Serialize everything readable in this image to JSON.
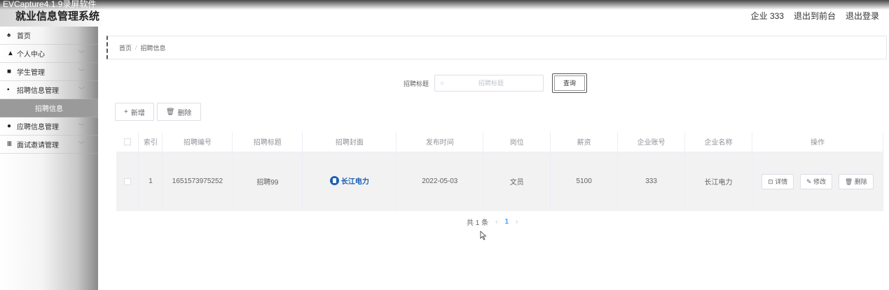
{
  "header": {
    "capture_title": "EVCapture4.1.9录屏软件",
    "app_title": "就业信息管理系统",
    "right_links": [
      "企业 333",
      "退出到前台",
      "退出登录"
    ]
  },
  "sidebar": {
    "items": [
      {
        "label": "首页",
        "icon": "home-icon",
        "glyph": "♠",
        "arrow": false
      },
      {
        "label": "个人中心",
        "icon": "user-icon",
        "glyph": "▲",
        "arrow": true
      },
      {
        "label": "学生管理",
        "icon": "id-card-icon",
        "glyph": "■",
        "arrow": true
      },
      {
        "label": "招聘信息管理",
        "icon": "grid-icon",
        "glyph": "▪",
        "arrow": true
      },
      {
        "label": "招聘信息",
        "sub": true
      },
      {
        "label": "应聘信息管理",
        "icon": "pin-icon",
        "glyph": "●",
        "arrow": true
      },
      {
        "label": "面试邀请管理",
        "icon": "bars-icon",
        "glyph": "Ⅲ",
        "arrow": true
      }
    ]
  },
  "breadcrumb": {
    "home": "首页",
    "separator": "/",
    "current": "招聘信息"
  },
  "search": {
    "label": "招聘标题",
    "placeholder": "招聘标题",
    "value": "",
    "button": "查询"
  },
  "actions": {
    "add": "新增",
    "delete": "删除"
  },
  "table": {
    "columns": [
      "",
      "索引",
      "招聘编号",
      "招聘标题",
      "招聘封面",
      "发布时间",
      "岗位",
      "薪资",
      "企业账号",
      "企业名称",
      "操作"
    ],
    "rows": [
      {
        "index": "1",
        "code": "1651573975252",
        "title": "招聘99",
        "cover_text": "长江电力",
        "date": "2022-05-03",
        "position": "文员",
        "salary": "5100",
        "account": "333",
        "company": "长江电力"
      }
    ],
    "row_actions": {
      "detail": "详情",
      "edit": "修改",
      "delete": "删除"
    }
  },
  "pagination": {
    "total": "共 1 条",
    "current": "1"
  }
}
